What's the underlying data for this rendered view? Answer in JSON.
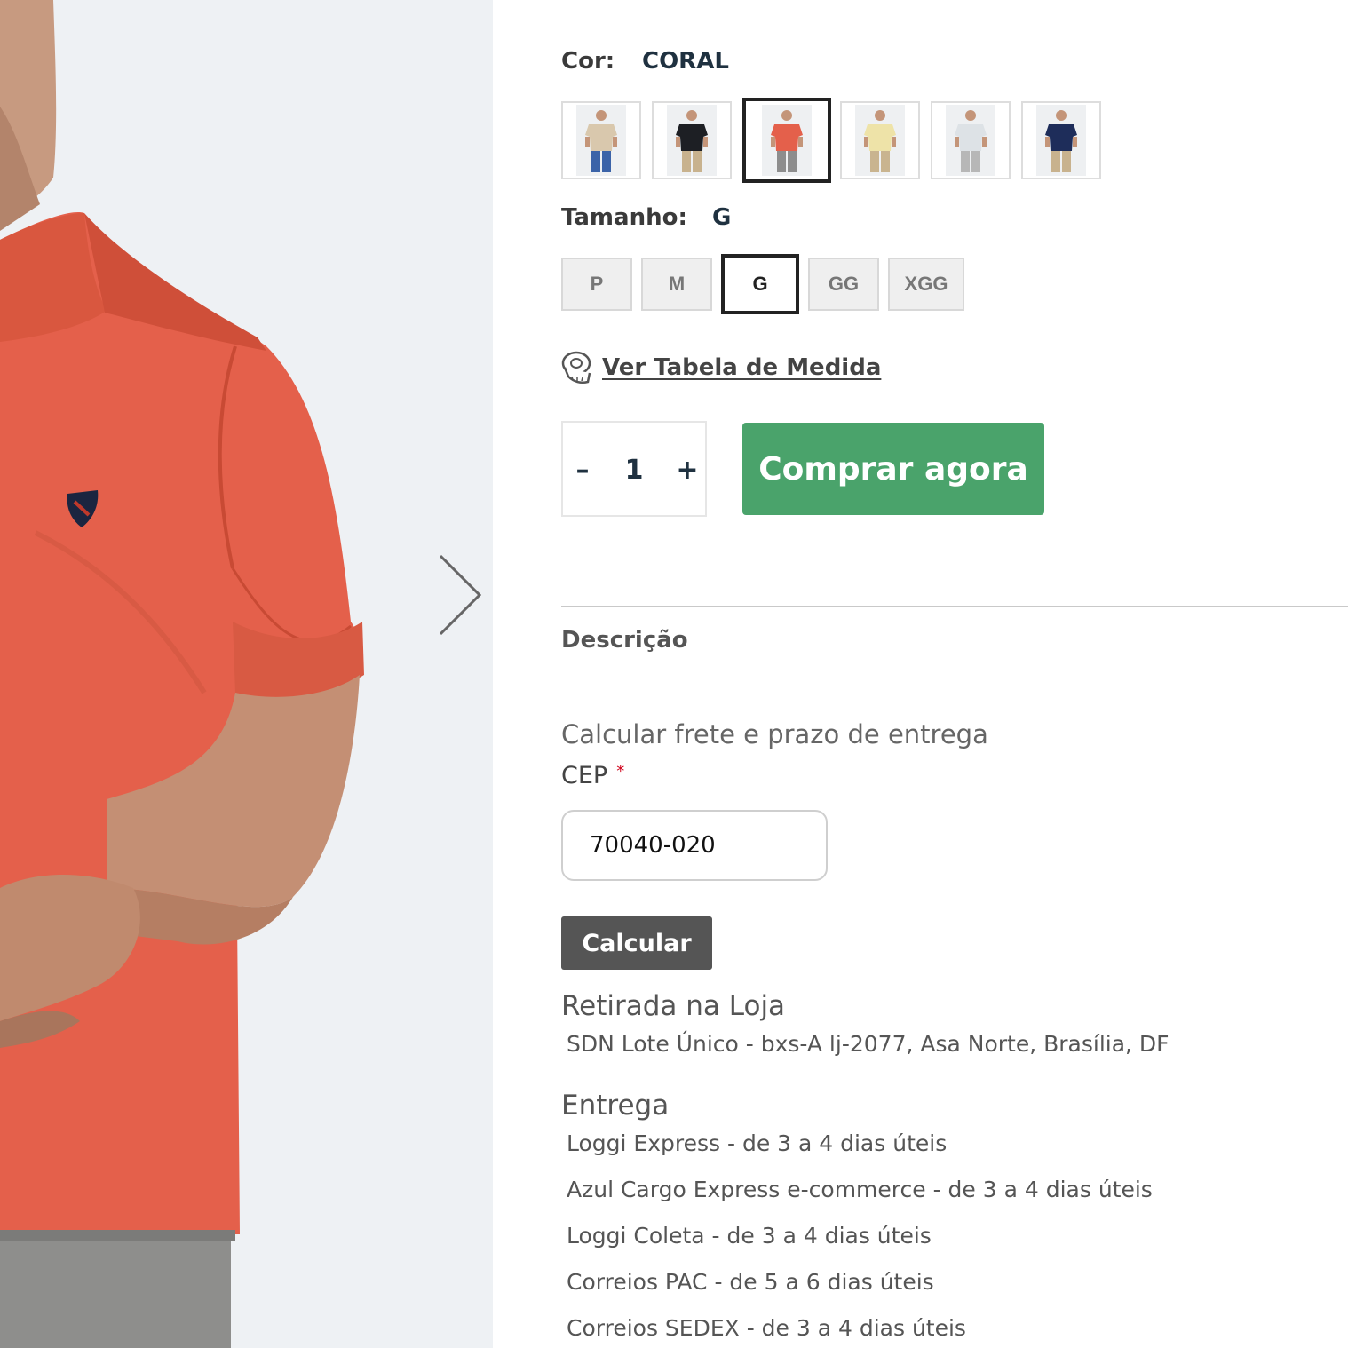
{
  "product": {
    "color_label": "Cor:",
    "color_value": "CORAL",
    "color_swatches": [
      {
        "name": "bege",
        "shirt": "#d9c8ad",
        "pants": "#3b63a8",
        "active": false
      },
      {
        "name": "preto",
        "shirt": "#1d1f24",
        "pants": "#c8b28e",
        "active": false
      },
      {
        "name": "coral",
        "shirt": "#e4604b",
        "pants": "#8d8d8d",
        "active": true
      },
      {
        "name": "amarelo",
        "shirt": "#eee3a8",
        "pants": "#c9b48f",
        "active": false
      },
      {
        "name": "cinza-claro",
        "shirt": "#dde2e6",
        "pants": "#b7b7b7",
        "active": false
      },
      {
        "name": "marinho",
        "shirt": "#1e2d5a",
        "pants": "#c8b28e",
        "active": false
      }
    ],
    "size_label": "Tamanho:",
    "size_value": "G",
    "sizes": [
      "P",
      "M",
      "G",
      "GG",
      "XGG"
    ],
    "size_chart_link": "Ver Tabela de Medida",
    "quantity": {
      "minus": "–",
      "value": "1",
      "plus": "+"
    },
    "buy_button": "Comprar agora",
    "description_tab": "Descrição"
  },
  "shipping": {
    "title": "Calcular frete e prazo de entrega",
    "cep_label": "CEP",
    "required_mark": "*",
    "cep_value": "70040-020",
    "calculate_button": "Calcular",
    "pickup_title": "Retirada na Loja",
    "pickup_address": "SDN Lote Único - bxs-A lj-2077, Asa Norte, Brasília, DF",
    "delivery_title": "Entrega",
    "delivery_options": [
      "Loggi Express - de 3 a 4 dias úteis",
      "Azul Cargo Express e-commerce - de 3 a 4 dias úteis",
      "Loggi Coleta - de 3 a 4 dias úteis",
      "Correios PAC - de 5 a 6 dias úteis",
      "Correios SEDEX - de 3 a 4 dias úteis"
    ]
  },
  "icons": {
    "next": "chevron-right-icon",
    "measure": "measuring-tape-icon"
  },
  "colors": {
    "buy": "#4aa36b",
    "calculate": "#555555",
    "shirt": "#e4604b",
    "required": "#d0021b"
  }
}
